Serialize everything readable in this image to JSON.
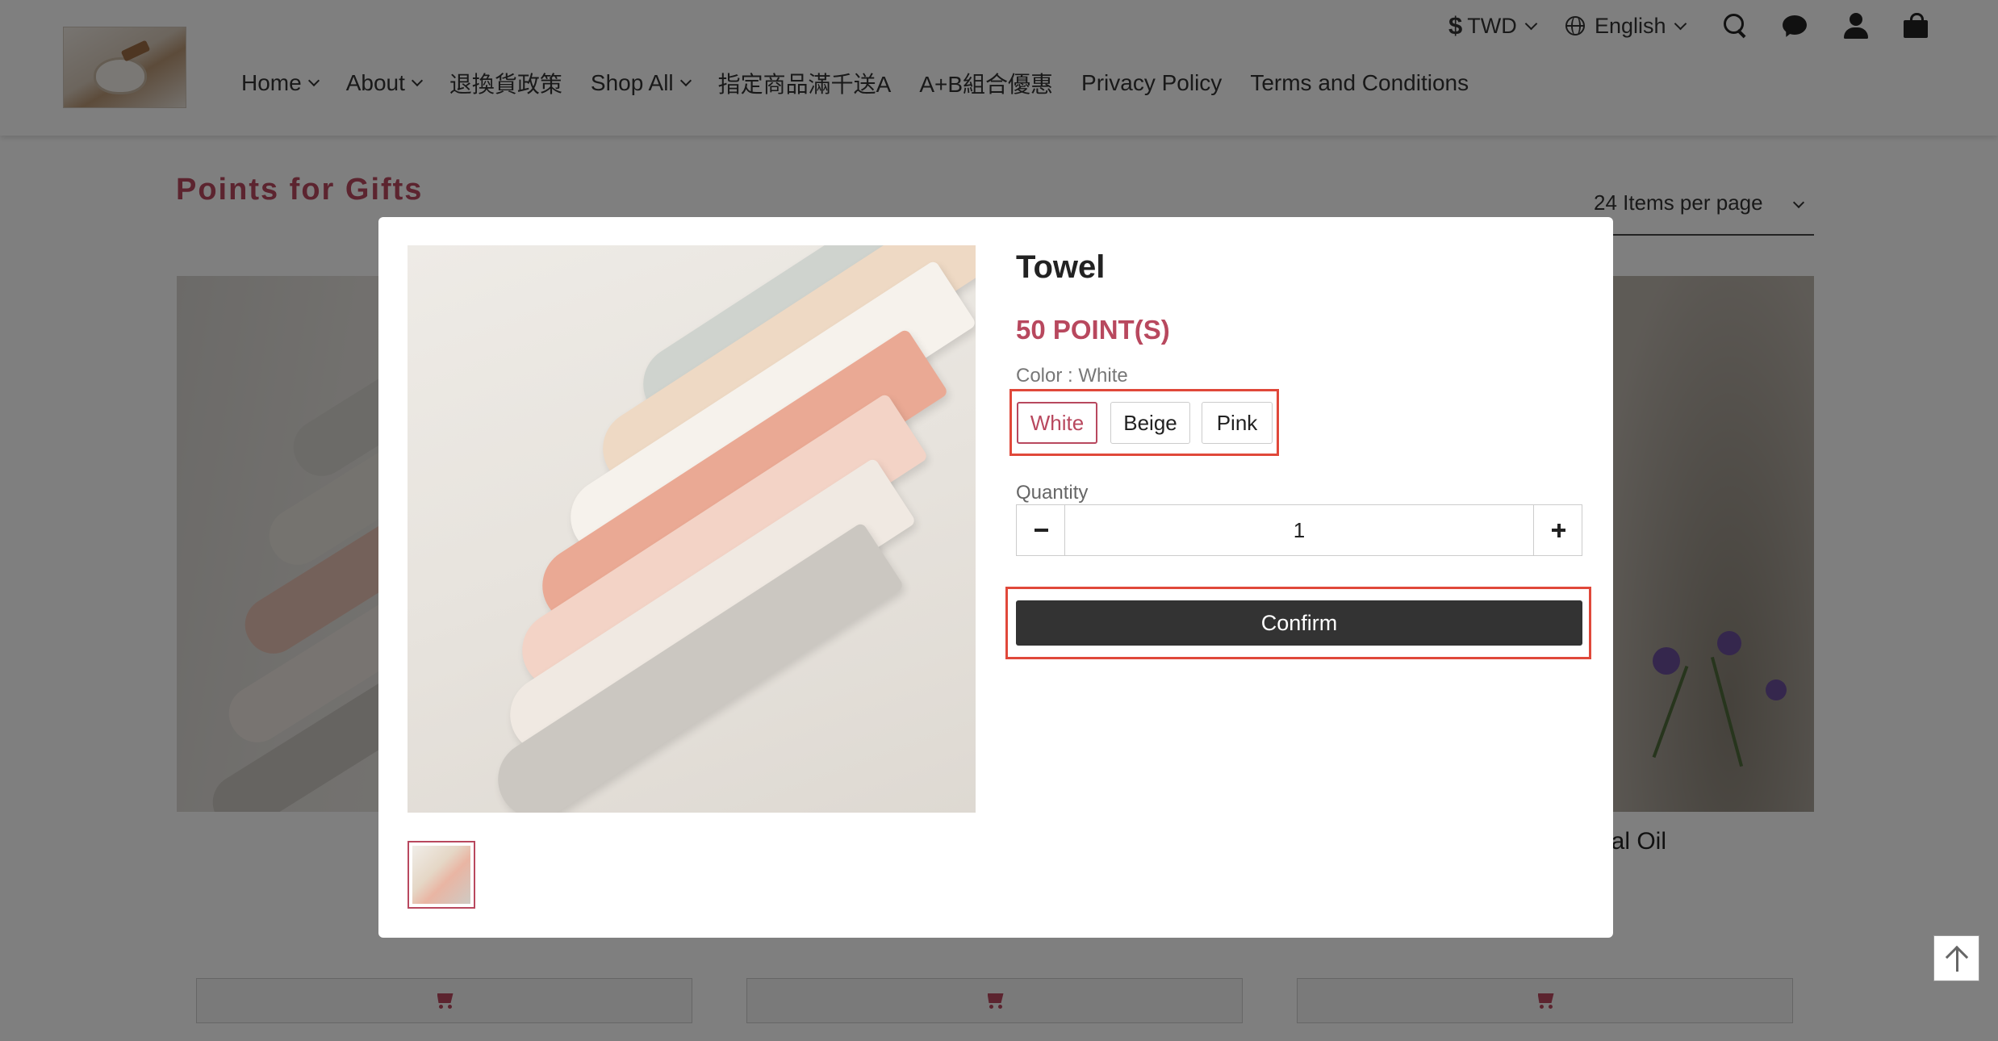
{
  "header": {
    "currency": {
      "symbol": "$",
      "label": "TWD"
    },
    "language": {
      "label": "English"
    },
    "icons": [
      "search-icon",
      "chat-icon",
      "user-icon",
      "bag-icon"
    ],
    "nav": [
      {
        "label": "Home",
        "dropdown": true
      },
      {
        "label": "About",
        "dropdown": true
      },
      {
        "label": "退換貨政策",
        "dropdown": false
      },
      {
        "label": "Shop All",
        "dropdown": true
      },
      {
        "label": "指定商品滿千送A",
        "dropdown": false
      },
      {
        "label": "A+B組合優惠",
        "dropdown": false
      },
      {
        "label": "Privacy Policy",
        "dropdown": false
      },
      {
        "label": "Terms and Conditions",
        "dropdown": false
      }
    ]
  },
  "page": {
    "title": "Points for Gifts",
    "per_page": "24 Items per page",
    "right_product_name": "ial Oil"
  },
  "modal": {
    "title": "Towel",
    "price": "50 POINT(S)",
    "variant_label": "Color : White",
    "variants": [
      {
        "label": "White",
        "selected": true
      },
      {
        "label": "Beige",
        "selected": false
      },
      {
        "label": "Pink",
        "selected": false
      }
    ],
    "quantity_label": "Quantity",
    "quantity_value": "1",
    "confirm_label": "Confirm"
  },
  "colors": {
    "accent": "#b8485e",
    "highlight_box": "#e0483a",
    "button_dark": "#333333",
    "overlay": "rgba(0,0,0,0.5)"
  }
}
